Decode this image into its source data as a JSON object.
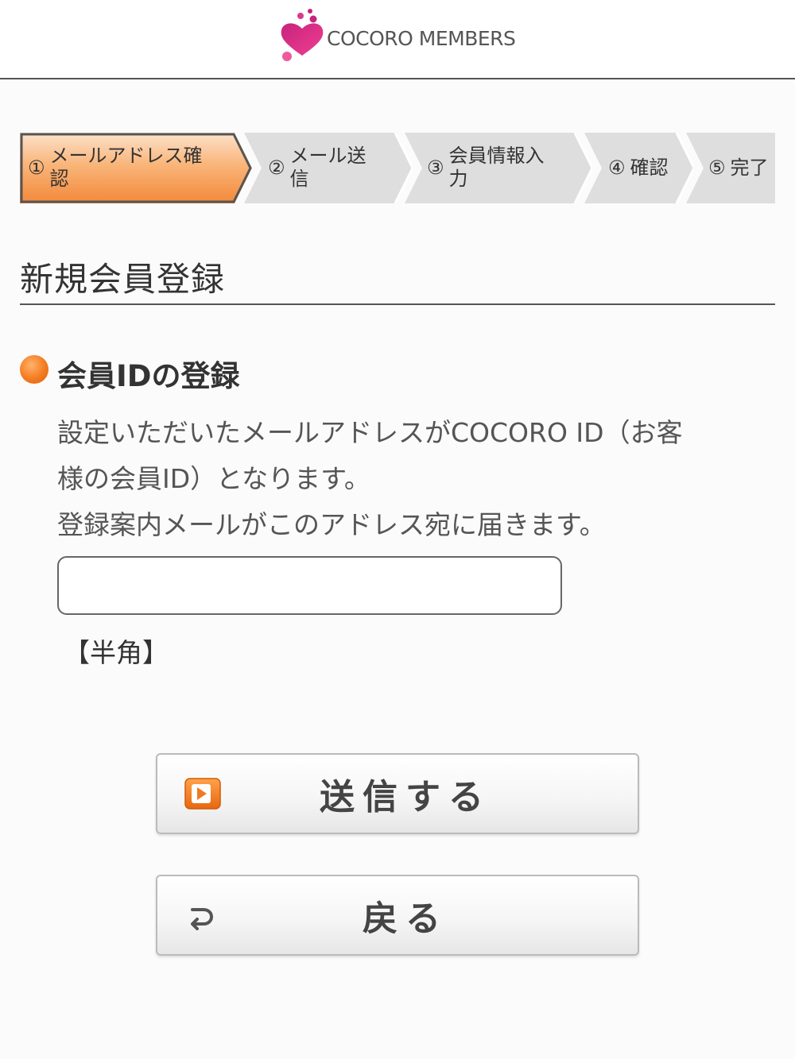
{
  "header": {
    "brand": "COCORO MEMBERS"
  },
  "steps": [
    {
      "num": "①",
      "label": "メールアドレス確\n認",
      "active": true
    },
    {
      "num": "②",
      "label": "メール送\n信",
      "active": false
    },
    {
      "num": "③",
      "label": "会員情報入\n力",
      "active": false
    },
    {
      "num": "④",
      "label": "確認",
      "active": false
    },
    {
      "num": "⑤",
      "label": "完了",
      "active": false
    }
  ],
  "page": {
    "title": "新規会員登録"
  },
  "section": {
    "title": "会員IDの登録",
    "desc_line1": "設定いただいたメールアドレスがCOCORO ID（お客",
    "desc_line2": "様の会員ID）となります。",
    "desc_line3": "登録案内メールがこのアドレス宛に届きます。",
    "email_value": "",
    "hankaku": "【半角】"
  },
  "buttons": {
    "submit": "送信する",
    "back": "戻る"
  },
  "colors": {
    "accent": "#f47a1f",
    "step_active": "#f6a15c",
    "step_inactive": "#dedede",
    "logo_pink": "#e4348b"
  }
}
